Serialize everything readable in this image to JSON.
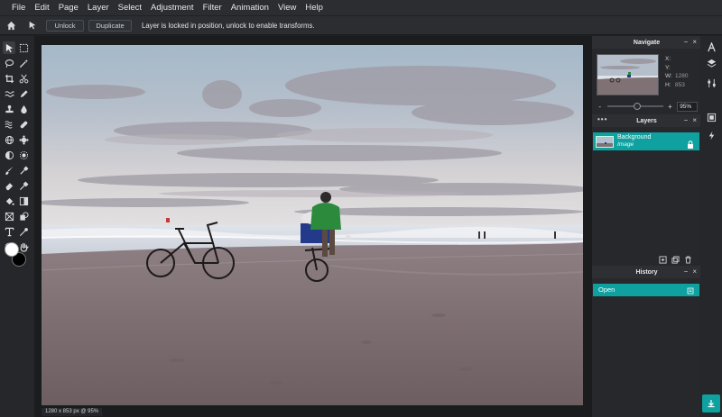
{
  "menu": [
    "File",
    "Edit",
    "Page",
    "Layer",
    "Select",
    "Adjustment",
    "Filter",
    "Animation",
    "View",
    "Help"
  ],
  "options": {
    "unlock_label": "Unlock",
    "duplicate_label": "Duplicate",
    "message": "Layer is locked in position, unlock to enable transforms."
  },
  "status": "1280 x 853 px @ 95%",
  "navigate": {
    "title": "Navigate",
    "x_label": "X:",
    "y_label": "Y:",
    "w_label": "W:",
    "h_label": "H:",
    "w_value": "1280",
    "h_value": "853",
    "zoom_value": "95%",
    "minus": "-",
    "plus": "+"
  },
  "layers": {
    "title": "Layers",
    "items": [
      {
        "name": "Background",
        "type": "Image"
      }
    ]
  },
  "history": {
    "title": "History",
    "items": [
      {
        "label": "Open"
      }
    ]
  },
  "colors": {
    "accent": "#0fa0a0",
    "foreground": "#ffffff",
    "background": "#000000"
  },
  "icons": {
    "left_tools": [
      "move-icon",
      "marquee-icon",
      "lasso-icon",
      "magic-wand-icon",
      "crop-icon",
      "cut-icon",
      "brush-heal-icon",
      "pencil-icon",
      "stamp-icon",
      "drop-icon",
      "wave-icon",
      "smudge-icon",
      "sphere-icon",
      "gear-fill-icon",
      "dodge-icon",
      "sun-icon",
      "brush-icon",
      "eyedropper-icon",
      "eraser-icon",
      "color-picker-icon",
      "bucket-icon",
      "gradient-icon",
      "shape-icon",
      "shape2-icon",
      "text-icon",
      "eyedropper2-icon",
      "zoom-icon",
      "hand-icon"
    ],
    "rail": [
      "character-icon",
      "layers-stack-icon",
      "adjust-icon",
      "crop-rail-icon",
      "magic-icon"
    ]
  }
}
